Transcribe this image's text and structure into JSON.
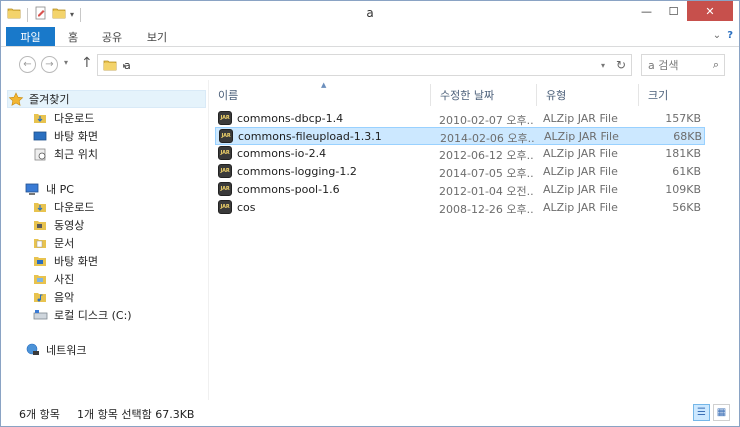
{
  "window": {
    "title": "a",
    "controls": {
      "minimize": "—",
      "maximize": "☐",
      "close": "✕"
    }
  },
  "ribbon": {
    "tabs": [
      {
        "label": "파일"
      },
      {
        "label": "홈"
      },
      {
        "label": "공유"
      },
      {
        "label": "보기"
      }
    ],
    "collapse_icon": "chevron-down-icon",
    "help_icon": "help-icon",
    "collapse_glyph": "⌄",
    "help_glyph": "?"
  },
  "address": {
    "back_glyph": "←",
    "forward_glyph": "→",
    "up_glyph": "↑",
    "crumb_sep": "▸",
    "path": "a",
    "refresh_glyph": "↻",
    "dropdown_glyph": "▾"
  },
  "search": {
    "placeholder": "a 검색",
    "icon_glyph": "⌕"
  },
  "nav_pane": {
    "favorites": {
      "label": "즐겨찾기",
      "items": [
        "다운로드",
        "바탕 화면",
        "최근 위치"
      ]
    },
    "pc": {
      "label": "내 PC",
      "items": [
        "다운로드",
        "동영상",
        "문서",
        "바탕 화면",
        "사진",
        "음악",
        "로컬 디스크 (C:)"
      ]
    },
    "network": {
      "label": "네트워크"
    }
  },
  "columns": {
    "name": "이름",
    "date": "수정한 날짜",
    "type": "유형",
    "size": "크기",
    "sort_glyph": "▲"
  },
  "files": [
    {
      "name": "commons-dbcp-1.4",
      "date": "2010-02-07 오후...",
      "type": "ALZip JAR File",
      "size": "157KB",
      "selected": false
    },
    {
      "name": "commons-fileupload-1.3.1",
      "date": "2014-02-06 오후...",
      "type": "ALZip JAR File",
      "size": "68KB",
      "selected": true
    },
    {
      "name": "commons-io-2.4",
      "date": "2012-06-12 오후...",
      "type": "ALZip JAR File",
      "size": "181KB",
      "selected": false
    },
    {
      "name": "commons-logging-1.2",
      "date": "2014-07-05 오후...",
      "type": "ALZip JAR File",
      "size": "61KB",
      "selected": false
    },
    {
      "name": "commons-pool-1.6",
      "date": "2012-01-04 오전...",
      "type": "ALZip JAR File",
      "size": "109KB",
      "selected": false
    },
    {
      "name": "cos",
      "date": "2008-12-26 오후...",
      "type": "ALZip JAR File",
      "size": "56KB",
      "selected": false
    }
  ],
  "jar_icon_text": "JAR",
  "status": {
    "count": "6개 항목",
    "selection": "1개 항목 선택함 67.3KB"
  },
  "colors": {
    "accent": "#1979ca",
    "selection": "#cce8ff",
    "close": "#c7504c"
  }
}
